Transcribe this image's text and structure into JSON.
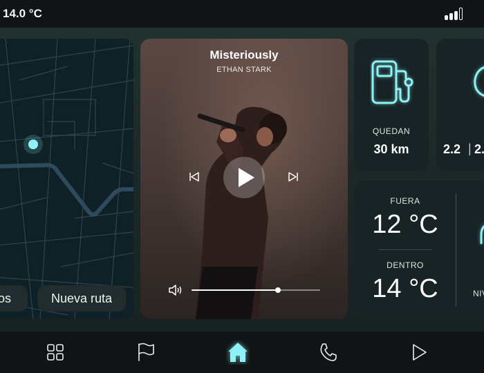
{
  "status": {
    "temperature": "14.0 °C",
    "signal_icon": "signal-bars-icon"
  },
  "map": {
    "buttons": [
      {
        "label": "tos"
      },
      {
        "label": "Nueva ruta"
      }
    ]
  },
  "music": {
    "title": "Misteriously",
    "artist": "ETHAN STARK",
    "volume_level": 0.67
  },
  "fuel": {
    "icon": "fuel-pump-icon",
    "label": "QUEDAN",
    "value": "30 km"
  },
  "eco": {
    "icon": "leaf-icon",
    "value_a": "2.2",
    "value_b": "2.",
    "separator": "|"
  },
  "climate": {
    "outside_label": "FUERA",
    "outside_value": "12 °C",
    "inside_label": "DENTRO",
    "inside_value": "14 °C",
    "right_label": "NIV"
  },
  "nav": {
    "items": [
      {
        "icon": "grid-icon"
      },
      {
        "icon": "flag-icon"
      },
      {
        "icon": "home-icon",
        "active": true
      },
      {
        "icon": "phone-icon"
      },
      {
        "icon": "play-icon"
      }
    ]
  },
  "colors": {
    "accent": "#8ef2f6",
    "background": "#0f1516",
    "panel": "#172325"
  }
}
